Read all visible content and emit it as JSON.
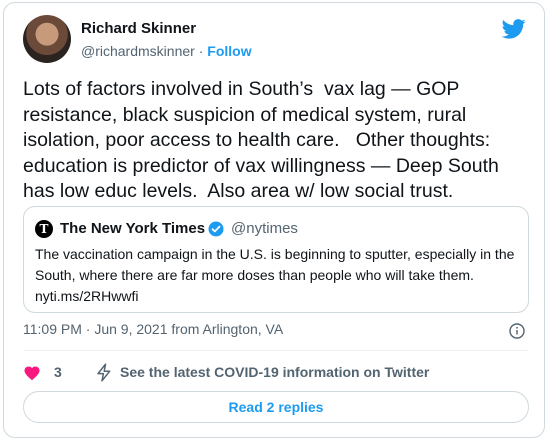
{
  "author": {
    "name": "Richard Skinner",
    "handle": "@richardmskinner",
    "separator": " · ",
    "follow_label": "Follow"
  },
  "icons": {
    "brand": "bird-icon",
    "verified": "verified-badge-icon",
    "info": "info-icon",
    "like": "heart-icon",
    "covid": "lightning-icon"
  },
  "tweet": {
    "text": "Lots of factors involved in South’s  vax lag — GOP resistance, black suspicion of medical system, rural isolation, poor access to health care.   Other thoughts: education is predictor of vax willingness — Deep South has low educ levels.  Also area w/ low social trust."
  },
  "quoted": {
    "logo_glyph": "T",
    "name": "The New York Times",
    "handle": "@nytimes",
    "text": "The vaccination campaign in the U.S. is beginning to sputter, especially in the South, where there are far more doses than people who will take them. nyti.ms/2RHwwfi"
  },
  "meta": {
    "timestamp": "11:09 PM · Jun 9, 2021 from Arlington, VA"
  },
  "actions": {
    "like_count": "3",
    "covid_info": "See the latest COVID-19 information on Twitter"
  },
  "replies_button": "Read 2 replies",
  "colors": {
    "accent": "#1d9bf0",
    "like": "#f91880",
    "text": "#0f1419",
    "muted": "#536471",
    "border": "#cfd9de"
  }
}
